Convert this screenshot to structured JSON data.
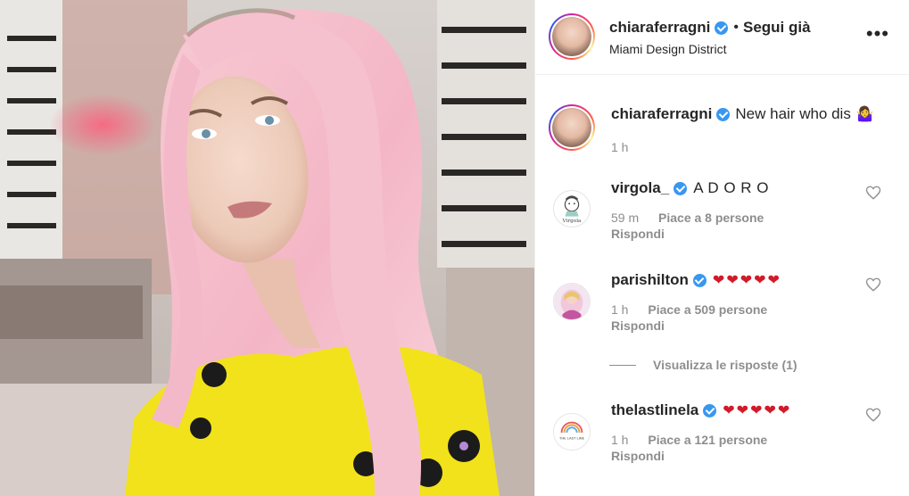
{
  "header": {
    "username": "chiaraferragni",
    "separator": "•",
    "follow_state": "Segui già",
    "location": "Miami Design District",
    "more_icon": "more-horizontal-icon"
  },
  "caption": {
    "username": "chiaraferragni",
    "text": "New hair who dis",
    "emoji": "🤷‍♀️",
    "time": "1 h"
  },
  "comments": [
    {
      "username": "virgola_",
      "text": "A D O R O",
      "time": "59 m",
      "likes": "Piace a 8 persone",
      "reply": "Rispondi"
    },
    {
      "username": "parishilton",
      "text": "❤❤❤❤❤",
      "time": "1 h",
      "likes": "Piace a 509 persone",
      "reply": "Rispondi"
    },
    {
      "username": "thelastlinela",
      "text": "❤❤❤❤❤",
      "time": "1 h",
      "likes": "Piace a 121 persone",
      "reply": "Rispondi"
    }
  ],
  "view_replies": "Visualizza le risposte (1)",
  "colors": {
    "verified": "#3897f0",
    "secondary_text": "#8e8e8e",
    "heart_emoji": "#d11a2a",
    "hair": "#f2b8c6",
    "top": "#f2e21b"
  },
  "avatar_texts": {
    "virgola": "Virgola",
    "thelastline": "THE LAST LINE"
  }
}
